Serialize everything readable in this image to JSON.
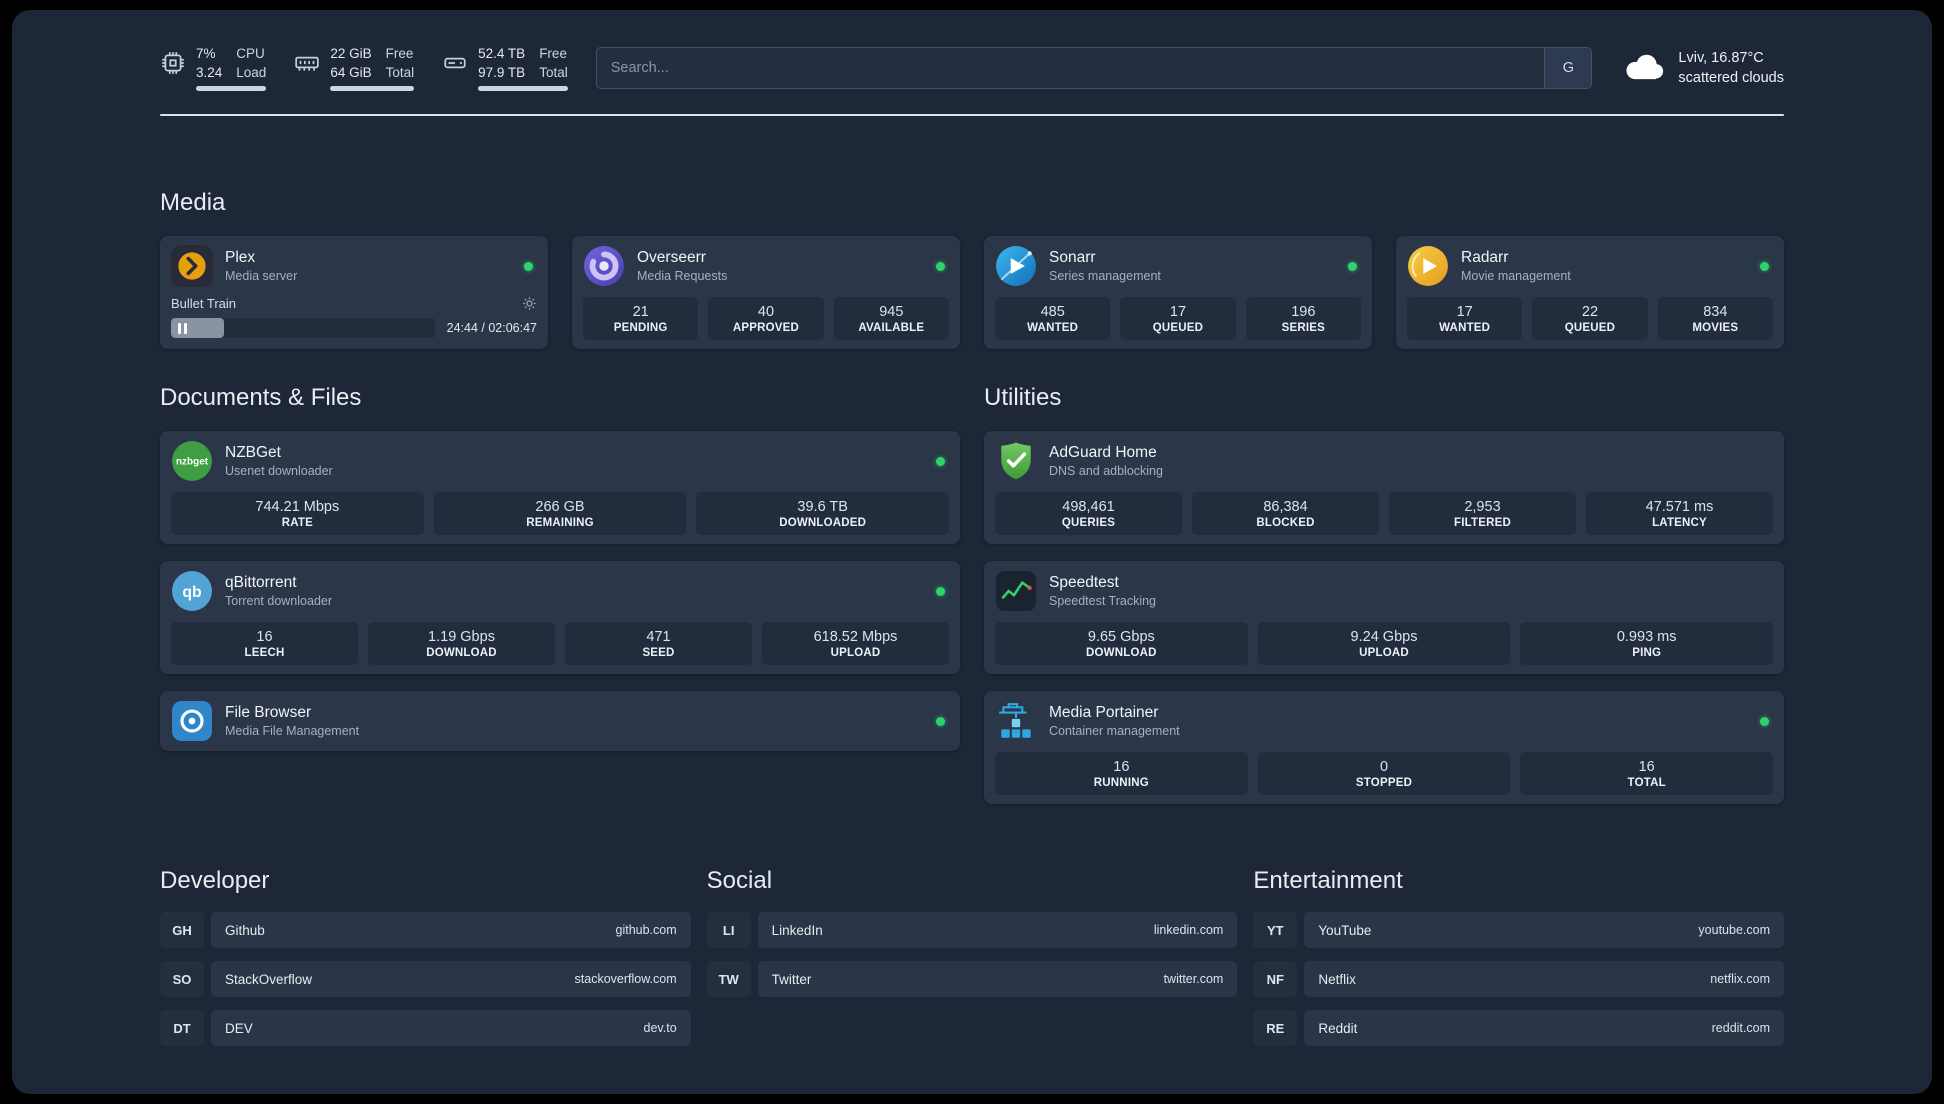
{
  "colors": {
    "page_bg": "#1d2737",
    "card_bg": "#2b3648",
    "stat_bg": "#212c3d",
    "status_online": "#2fd26b",
    "plex_accent": "#e5a00d"
  },
  "icons": {
    "search_provider": "G",
    "weather_icon": "cloud",
    "metric_icons": [
      "cpu-chip",
      "memory-stick",
      "hard-disk"
    ]
  },
  "topbar": {
    "cpu": {
      "percent": "7%",
      "load": "3.24",
      "labels": [
        "CPU",
        "Load"
      ]
    },
    "memory": {
      "free": "22 GiB",
      "total": "64 GiB",
      "labels": [
        "Free",
        "Total"
      ]
    },
    "disk": {
      "free": "52.4 TB",
      "total": "97.9 TB",
      "labels": [
        "Free",
        "Total"
      ]
    },
    "search": {
      "placeholder": "Search...",
      "provider": "G"
    },
    "weather": {
      "location": "Lviv, 16.87°C",
      "condition": "scattered clouds"
    }
  },
  "sections": {
    "media": "Media",
    "documents": "Documents & Files",
    "utilities": "Utilities"
  },
  "apps": {
    "plex": {
      "name": "Plex",
      "desc": "Media server",
      "status": "online",
      "now_playing": "Bullet Train",
      "progress_time": "24:44 / 02:06:47"
    },
    "overseerr": {
      "name": "Overseerr",
      "desc": "Media Requests",
      "status": "online",
      "stats": [
        {
          "value": "21",
          "label": "PENDING"
        },
        {
          "value": "40",
          "label": "APPROVED"
        },
        {
          "value": "945",
          "label": "AVAILABLE"
        }
      ]
    },
    "sonarr": {
      "name": "Sonarr",
      "desc": "Series management",
      "status": "online",
      "stats": [
        {
          "value": "485",
          "label": "WANTED"
        },
        {
          "value": "17",
          "label": "QUEUED"
        },
        {
          "value": "196",
          "label": "SERIES"
        }
      ]
    },
    "radarr": {
      "name": "Radarr",
      "desc": "Movie management",
      "status": "online",
      "stats": [
        {
          "value": "17",
          "label": "WANTED"
        },
        {
          "value": "22",
          "label": "QUEUED"
        },
        {
          "value": "834",
          "label": "MOVIES"
        }
      ]
    },
    "nzbget": {
      "name": "NZBGet",
      "desc": "Usenet downloader",
      "status": "online",
      "stats": [
        {
          "value": "744.21 Mbps",
          "label": "RATE"
        },
        {
          "value": "266 GB",
          "label": "REMAINING"
        },
        {
          "value": "39.6 TB",
          "label": "DOWNLOADED"
        }
      ]
    },
    "qbittorrent": {
      "name": "qBittorrent",
      "desc": "Torrent downloader",
      "status": "online",
      "stats": [
        {
          "value": "16",
          "label": "LEECH"
        },
        {
          "value": "1.19 Gbps",
          "label": "DOWNLOAD"
        },
        {
          "value": "471",
          "label": "SEED"
        },
        {
          "value": "618.52 Mbps",
          "label": "UPLOAD"
        }
      ]
    },
    "filebrowser": {
      "name": "File Browser",
      "desc": "Media File Management",
      "status": "online"
    },
    "adguard": {
      "name": "AdGuard Home",
      "desc": "DNS and adblocking",
      "stats": [
        {
          "value": "498,461",
          "label": "QUERIES"
        },
        {
          "value": "86,384",
          "label": "BLOCKED"
        },
        {
          "value": "2,953",
          "label": "FILTERED"
        },
        {
          "value": "47.571 ms",
          "label": "LATENCY"
        }
      ]
    },
    "speedtest": {
      "name": "Speedtest",
      "desc": "Speedtest Tracking",
      "stats": [
        {
          "value": "9.65 Gbps",
          "label": "DOWNLOAD"
        },
        {
          "value": "9.24 Gbps",
          "label": "UPLOAD"
        },
        {
          "value": "0.993 ms",
          "label": "PING"
        }
      ]
    },
    "portainer": {
      "name": "Media Portainer",
      "desc": "Container management",
      "status": "online",
      "stats": [
        {
          "value": "16",
          "label": "RUNNING"
        },
        {
          "value": "0",
          "label": "STOPPED"
        },
        {
          "value": "16",
          "label": "TOTAL"
        }
      ]
    }
  },
  "bookmarks": [
    {
      "title": "Developer",
      "items": [
        {
          "abbr": "GH",
          "name": "Github",
          "url": "github.com"
        },
        {
          "abbr": "SO",
          "name": "StackOverflow",
          "url": "stackoverflow.com"
        },
        {
          "abbr": "DT",
          "name": "DEV",
          "url": "dev.to"
        }
      ]
    },
    {
      "title": "Social",
      "items": [
        {
          "abbr": "LI",
          "name": "LinkedIn",
          "url": "linkedin.com"
        },
        {
          "abbr": "TW",
          "name": "Twitter",
          "url": "twitter.com"
        }
      ]
    },
    {
      "title": "Entertainment",
      "items": [
        {
          "abbr": "YT",
          "name": "YouTube",
          "url": "youtube.com"
        },
        {
          "abbr": "NF",
          "name": "Netflix",
          "url": "netflix.com"
        },
        {
          "abbr": "RE",
          "name": "Reddit",
          "url": "reddit.com"
        }
      ]
    }
  ]
}
